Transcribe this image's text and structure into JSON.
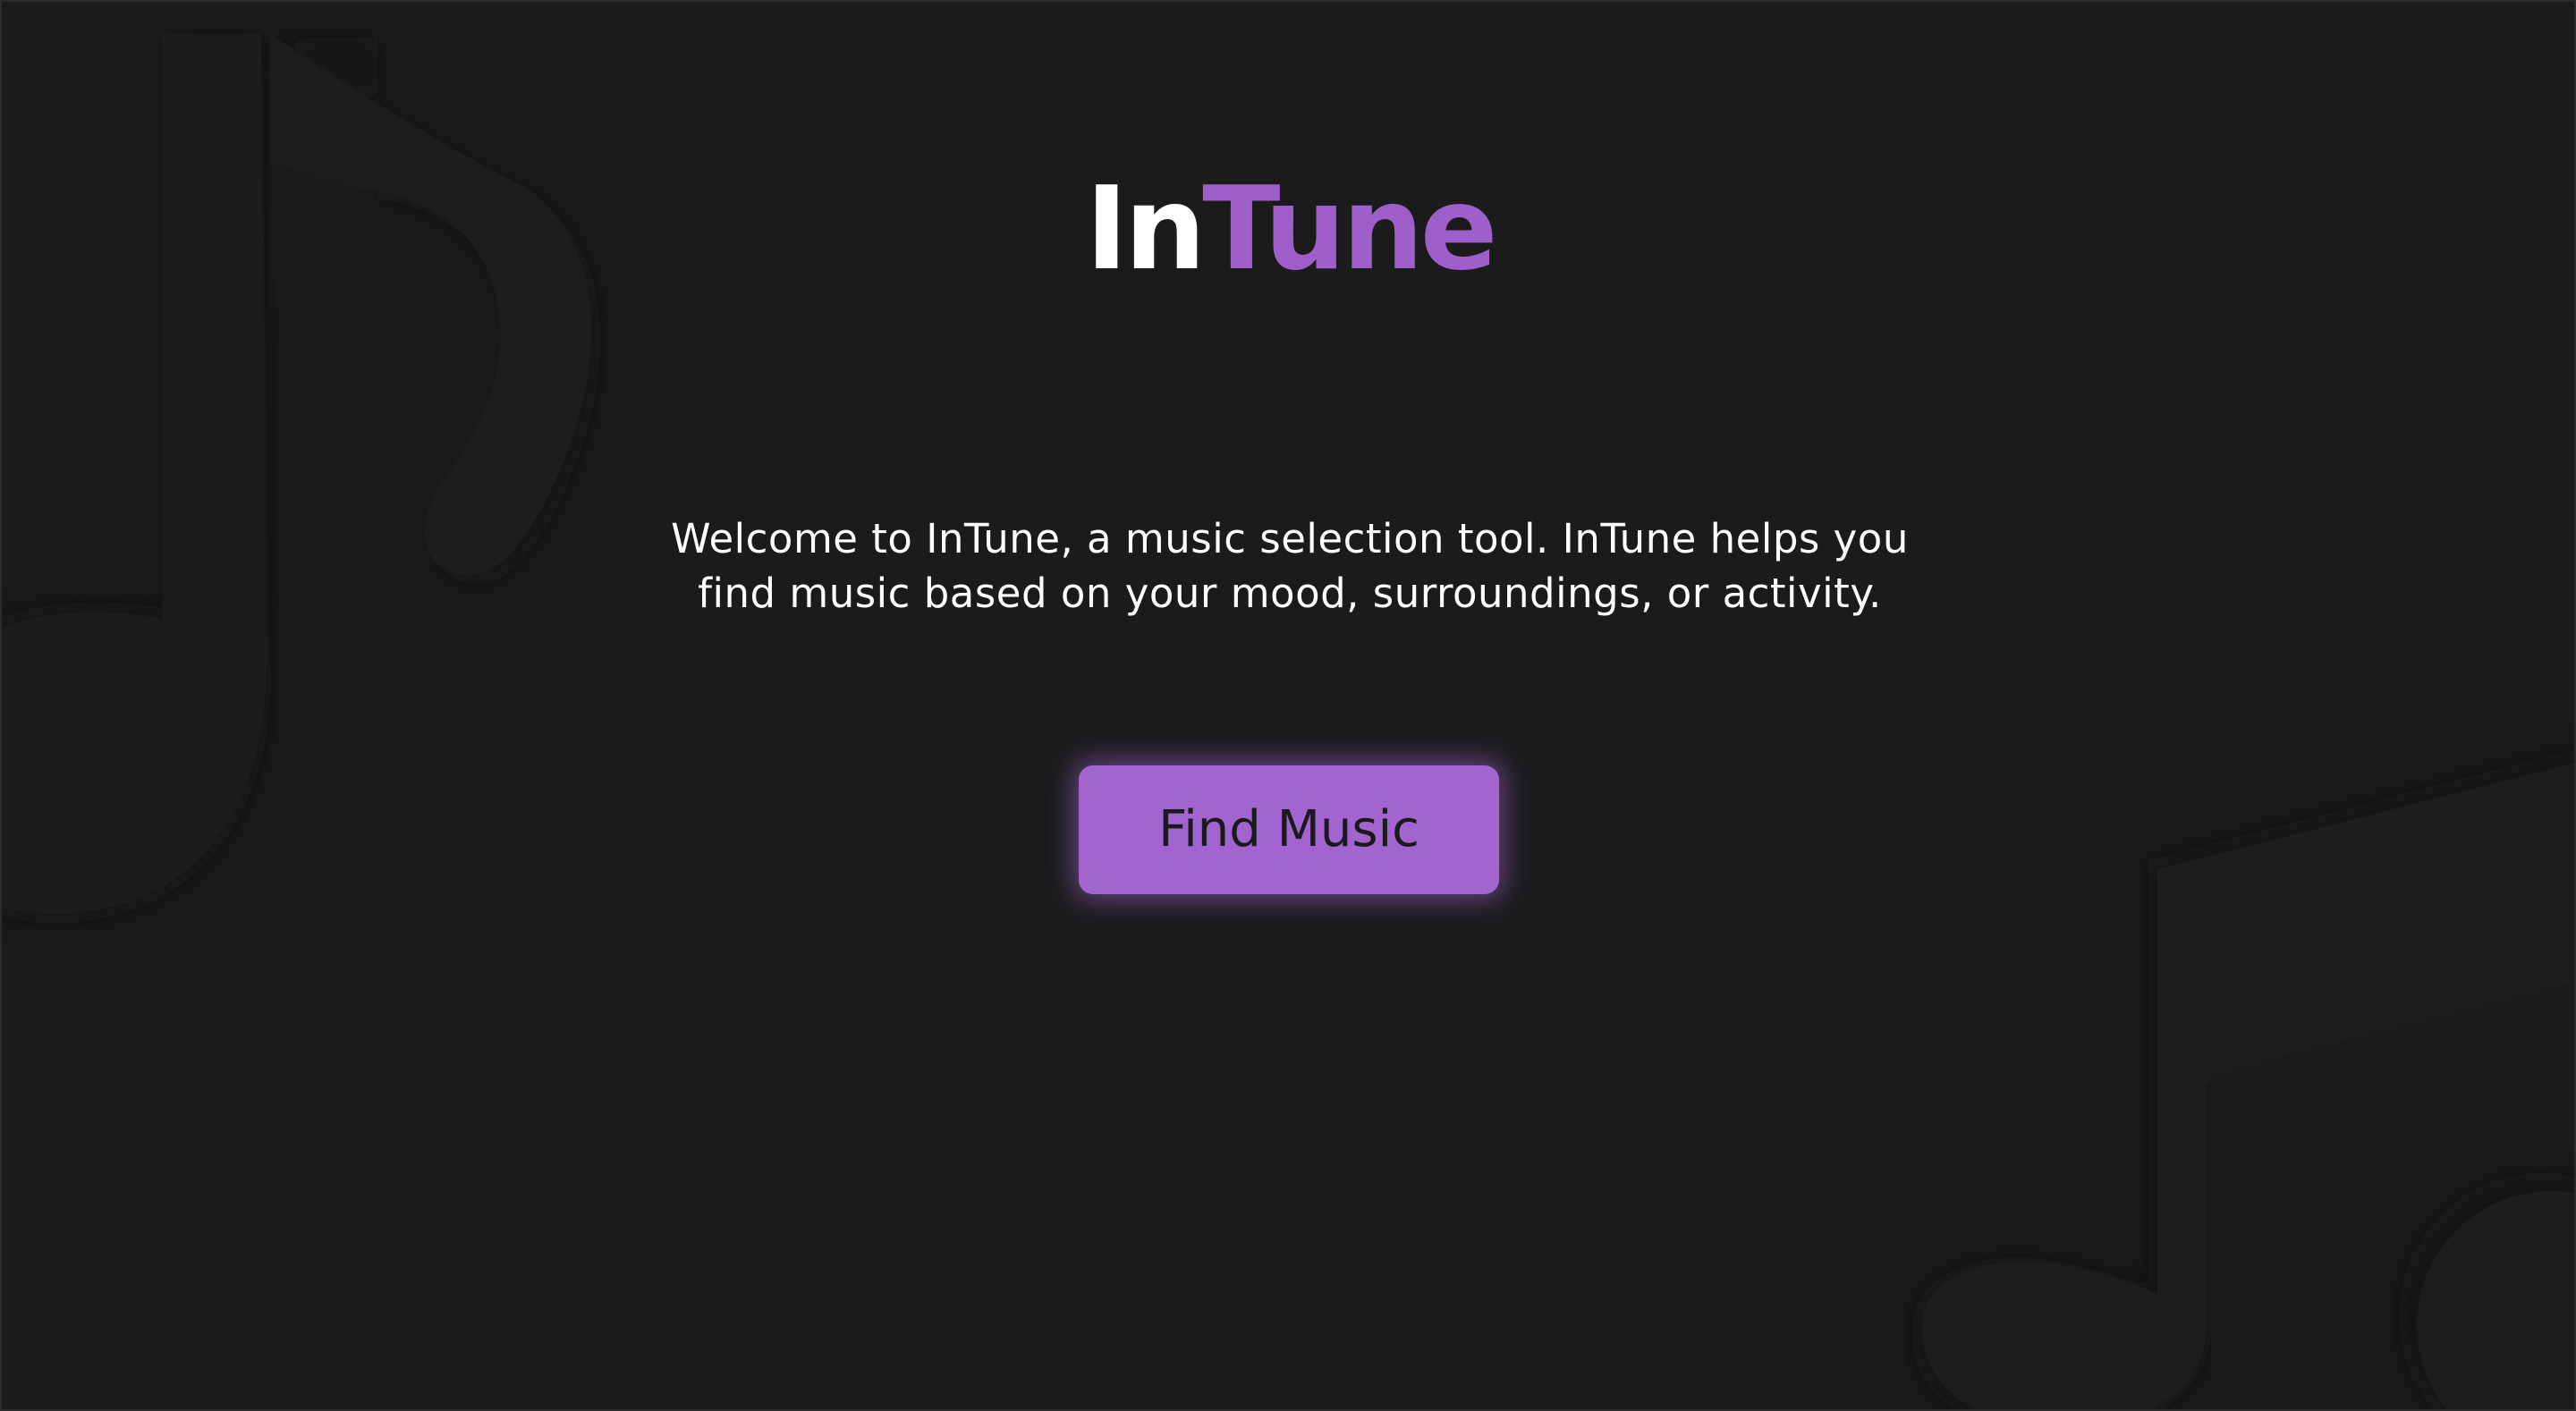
{
  "logo": {
    "part_one": "In",
    "part_two": "Tune"
  },
  "tagline": {
    "line1": "Welcome to InTune, a music selection tool. InTune helps you",
    "line2": "find music based on your mood, surroundings, or activity."
  },
  "cta": {
    "label": "Find Music"
  },
  "colors": {
    "background": "#1b1b1c",
    "accent": "#a264ce",
    "logo_white": "#ffffff",
    "logo_purple": "#9f5fcb",
    "button_text": "#1a1a1b"
  },
  "icons": [
    "music-note-icon",
    "music-note-icon"
  ]
}
